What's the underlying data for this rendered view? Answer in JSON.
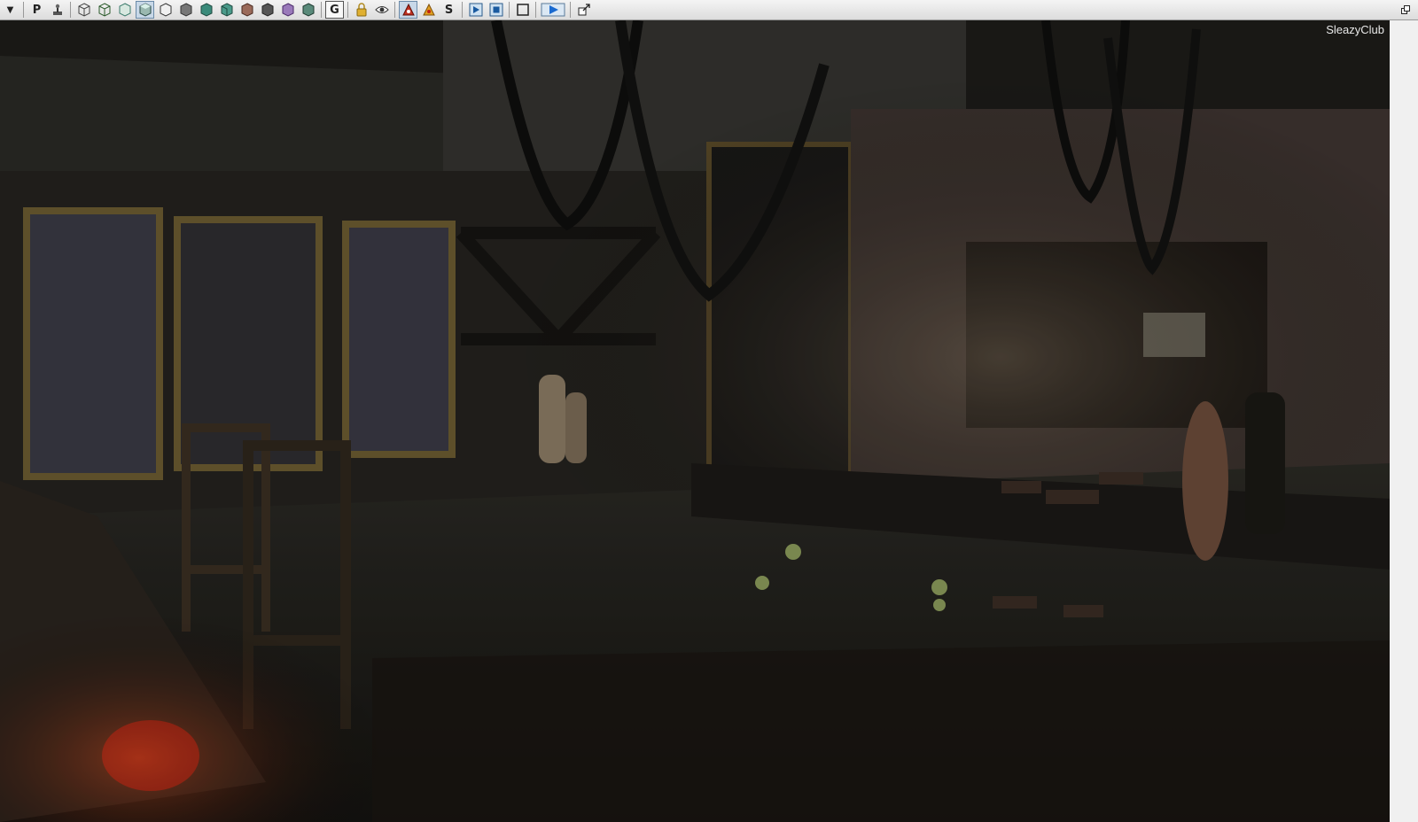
{
  "toolbar": {
    "buttons": [
      {
        "name": "menu-dropdown-button",
        "glyph": "▼"
      },
      {
        "name": "perspective-toggle-button",
        "glyph": "P"
      },
      {
        "name": "realtime-toggle-button",
        "glyph": "⛳"
      },
      {
        "name": "wireframe-view-button",
        "glyph": "⬡"
      },
      {
        "name": "brush-wireframe-view-button",
        "glyph": "⬡"
      },
      {
        "name": "unlit-view-button",
        "glyph": "⬢"
      },
      {
        "name": "lit-view-button",
        "glyph": "⬢"
      },
      {
        "name": "detail-lighting-view-button",
        "glyph": "⬢"
      },
      {
        "name": "lighting-only-view-button",
        "glyph": "⬢"
      },
      {
        "name": "light-complexity-view-button",
        "glyph": "⬢"
      },
      {
        "name": "texture-density-view-button",
        "glyph": "⬢"
      },
      {
        "name": "shader-complexity-view-button",
        "glyph": "⬢"
      },
      {
        "name": "lightmap-density-view-button",
        "glyph": "⬢"
      },
      {
        "name": "reflections-view-button",
        "glyph": "⬢"
      },
      {
        "name": "collision-view-button",
        "glyph": "⬢"
      },
      {
        "name": "game-view-button",
        "glyph": "G"
      },
      {
        "name": "lock-view-button",
        "glyph": "🔒"
      },
      {
        "name": "show-flags-button",
        "glyph": "👁"
      },
      {
        "name": "streaming-volumes-button",
        "glyph": "▲"
      },
      {
        "name": "post-process-button",
        "glyph": "▲"
      },
      {
        "name": "sound-button",
        "glyph": "S"
      },
      {
        "name": "matinee-preview-button",
        "glyph": "▶"
      },
      {
        "name": "stop-button",
        "glyph": "■"
      },
      {
        "name": "maximize-viewport-button",
        "glyph": "□"
      },
      {
        "name": "play-in-viewport-button",
        "glyph": "▶"
      },
      {
        "name": "detach-viewport-button",
        "glyph": "⧉"
      }
    ],
    "restore_glyph": "🗗"
  },
  "viewport": {
    "label": "SleazyClub"
  },
  "colors": {
    "toolbar_bg": "#e4e4e4",
    "viewport_dark": "#0e0d0b",
    "scene_brick": "#4a3a34",
    "scene_gold": "#8a7440",
    "accent_red": "#a81c14"
  }
}
